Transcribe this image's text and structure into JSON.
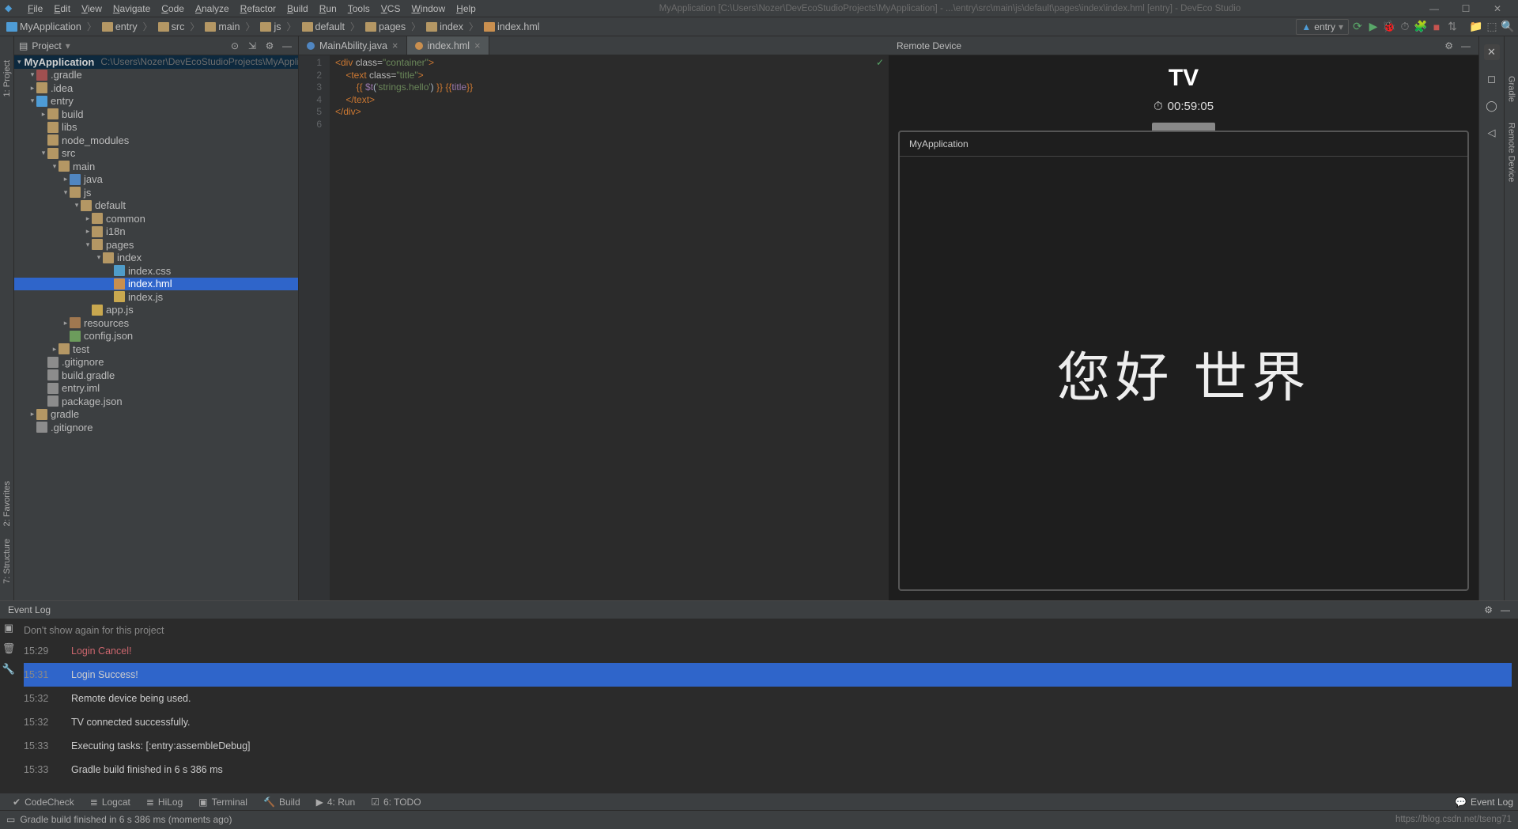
{
  "window": {
    "title": "MyApplication [C:\\Users\\Nozer\\DevEcoStudioProjects\\MyApplication] - ...\\entry\\src\\main\\js\\default\\pages\\index\\index.hml [entry] - DevEco Studio"
  },
  "menu": [
    "File",
    "Edit",
    "View",
    "Navigate",
    "Code",
    "Analyze",
    "Refactor",
    "Build",
    "Run",
    "Tools",
    "VCS",
    "Window",
    "Help"
  ],
  "breadcrumb": [
    "MyApplication",
    "entry",
    "src",
    "main",
    "js",
    "default",
    "pages",
    "index",
    "index.hml"
  ],
  "run_config": "entry",
  "project_panel": {
    "title": "Project",
    "root": "MyApplication",
    "root_path": "C:\\Users\\Nozer\\DevEcoStudioProjects\\MyApplication",
    "tree": [
      {
        "d": 1,
        "tw": "▾",
        "t": "folder",
        "k": "excl",
        "label": ".gradle"
      },
      {
        "d": 1,
        "tw": "▸",
        "t": "folder",
        "label": ".idea"
      },
      {
        "d": 1,
        "tw": "▾",
        "t": "module",
        "label": "entry"
      },
      {
        "d": 2,
        "tw": "▸",
        "t": "folder",
        "label": "build"
      },
      {
        "d": 2,
        "tw": "",
        "t": "folder",
        "label": "libs"
      },
      {
        "d": 2,
        "tw": "",
        "t": "folder",
        "label": "node_modules"
      },
      {
        "d": 2,
        "tw": "▾",
        "t": "folder",
        "label": "src"
      },
      {
        "d": 3,
        "tw": "▾",
        "t": "folder",
        "label": "main"
      },
      {
        "d": 4,
        "tw": "▸",
        "t": "folder",
        "k": "src",
        "label": "java"
      },
      {
        "d": 4,
        "tw": "▾",
        "t": "folder",
        "label": "js"
      },
      {
        "d": 5,
        "tw": "▾",
        "t": "folder",
        "label": "default"
      },
      {
        "d": 6,
        "tw": "▸",
        "t": "folder",
        "label": "common"
      },
      {
        "d": 6,
        "tw": "▸",
        "t": "folder",
        "label": "i18n"
      },
      {
        "d": 6,
        "tw": "▾",
        "t": "folder",
        "label": "pages"
      },
      {
        "d": 7,
        "tw": "▾",
        "t": "folder",
        "label": "index"
      },
      {
        "d": 8,
        "tw": "",
        "t": "file-css",
        "label": "index.css"
      },
      {
        "d": 8,
        "tw": "",
        "t": "file-hml",
        "label": "index.hml",
        "sel": true
      },
      {
        "d": 8,
        "tw": "",
        "t": "file-js",
        "label": "index.js"
      },
      {
        "d": 6,
        "tw": "",
        "t": "file-js",
        "label": "app.js"
      },
      {
        "d": 4,
        "tw": "▸",
        "t": "folder",
        "k": "res",
        "label": "resources"
      },
      {
        "d": 4,
        "tw": "",
        "t": "file-json",
        "label": "config.json"
      },
      {
        "d": 3,
        "tw": "▸",
        "t": "folder",
        "label": "test"
      },
      {
        "d": 2,
        "tw": "",
        "t": "file",
        "label": ".gitignore"
      },
      {
        "d": 2,
        "tw": "",
        "t": "file",
        "label": "build.gradle"
      },
      {
        "d": 2,
        "tw": "",
        "t": "file",
        "label": "entry.iml"
      },
      {
        "d": 2,
        "tw": "",
        "t": "file",
        "label": "package.json"
      },
      {
        "d": 1,
        "tw": "▸",
        "t": "folder",
        "label": "gradle"
      },
      {
        "d": 1,
        "tw": "",
        "t": "file",
        "label": ".gitignore"
      }
    ]
  },
  "tabs": [
    {
      "label": "MainAbility.java",
      "active": false,
      "icon": "class"
    },
    {
      "label": "index.hml",
      "active": true,
      "icon": "hml"
    }
  ],
  "code": {
    "lines": [
      {
        "n": 1,
        "seg": [
          {
            "c": "kw",
            "t": "<div "
          },
          {
            "c": "attr",
            "t": "class="
          },
          {
            "c": "str",
            "t": "\"container\""
          },
          {
            "c": "kw",
            "t": ">"
          }
        ]
      },
      {
        "n": 2,
        "ind": "    ",
        "seg": [
          {
            "c": "kw",
            "t": "<text "
          },
          {
            "c": "attr",
            "t": "class="
          },
          {
            "c": "str",
            "t": "\"title\""
          },
          {
            "c": "kw",
            "t": ">"
          }
        ]
      },
      {
        "n": 3,
        "ind": "        ",
        "seg": [
          {
            "c": "tmpl",
            "t": "{{ "
          },
          {
            "c": "var",
            "t": "$t"
          },
          {
            "c": "",
            "t": "("
          },
          {
            "c": "str",
            "t": "'strings.hello'"
          },
          {
            "c": "",
            "t": ") "
          },
          {
            "c": "tmpl",
            "t": "}} {{"
          },
          {
            "c": "var",
            "t": "title"
          },
          {
            "c": "tmpl",
            "t": "}}"
          }
        ]
      },
      {
        "n": 4,
        "ind": "    ",
        "seg": [
          {
            "c": "kw",
            "t": "</text>"
          }
        ]
      },
      {
        "n": 5,
        "seg": [
          {
            "c": "kw",
            "t": "</div>"
          }
        ]
      },
      {
        "n": 6,
        "seg": []
      }
    ]
  },
  "preview": {
    "title": "Remote Device",
    "device": "TV",
    "time": "00:59:05",
    "app_name": "MyApplication",
    "hello_text": "您好 世界"
  },
  "event_log": {
    "title": "Event Log",
    "hidden": "Don't show again for this project",
    "rows": [
      {
        "ts": "15:29",
        "msg": "Login Cancel!",
        "err": true
      },
      {
        "ts": "15:31",
        "msg": "Login Success!",
        "sel": true
      },
      {
        "ts": "15:32",
        "msg": "Remote device being used."
      },
      {
        "ts": "15:32",
        "msg": "TV connected successfully."
      },
      {
        "ts": "15:33",
        "msg": "Executing tasks: [:entry:assembleDebug]"
      },
      {
        "ts": "15:33",
        "msg": "Gradle build finished in 6 s 386 ms"
      }
    ]
  },
  "bottom_tabs": [
    "CodeCheck",
    "Logcat",
    "HiLog",
    "Terminal",
    "Build",
    "4: Run",
    "6: TODO"
  ],
  "bottom_right": "Event Log",
  "status": {
    "msg": "Gradle build finished in 6 s 386 ms (moments ago)",
    "watermark": "https://blog.csdn.net/tseng71"
  },
  "left_tabs": [
    "1: Project"
  ],
  "left_tabs2": [
    "2: Favorites",
    "7: Structure"
  ],
  "right_tabs": [
    "Gradle",
    "Remote Device"
  ]
}
